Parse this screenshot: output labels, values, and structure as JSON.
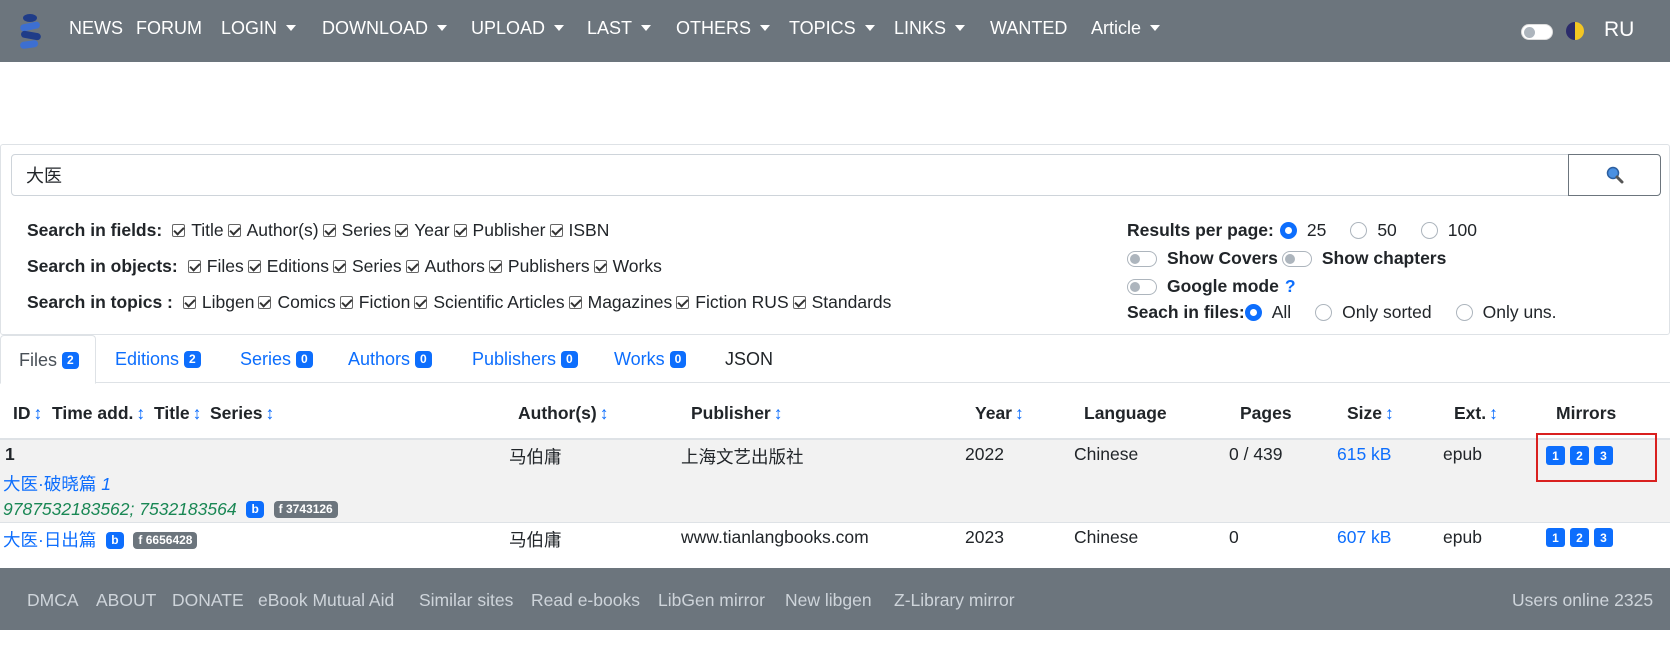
{
  "nav": {
    "items": [
      {
        "label": "NEWS",
        "dropdown": false
      },
      {
        "label": "FORUM",
        "dropdown": false
      },
      {
        "label": "LOGIN",
        "dropdown": true
      },
      {
        "label": "DOWNLOAD",
        "dropdown": true
      },
      {
        "label": "UPLOAD",
        "dropdown": true
      },
      {
        "label": "LAST",
        "dropdown": true
      },
      {
        "label": "OTHERS",
        "dropdown": true
      },
      {
        "label": "TOPICS",
        "dropdown": true
      },
      {
        "label": "LINKS",
        "dropdown": true
      },
      {
        "label": "WANTED",
        "dropdown": false
      },
      {
        "label": "Article",
        "dropdown": true
      }
    ],
    "lang": "RU"
  },
  "search": {
    "query": "大医",
    "fields_label": "Search in fields:",
    "fields": [
      "Title",
      "Author(s)",
      "Series",
      "Year",
      "Publisher",
      "ISBN"
    ],
    "objects_label": "Search in objects:",
    "objects": [
      "Files",
      "Editions",
      "Series",
      "Authors",
      "Publishers",
      "Works"
    ],
    "topics_label": "Search in topics :",
    "topics": [
      "Libgen",
      "Comics",
      "Fiction",
      "Scientific Articles",
      "Magazines",
      "Fiction RUS",
      "Standards"
    ],
    "results_label": "Results per page:",
    "results_options": [
      "25",
      "50",
      "100"
    ],
    "results_selected": "25",
    "show_covers": "Show Covers",
    "show_chapters": "Show chapters",
    "google_mode": "Google mode",
    "google_help": "?",
    "files_label": "Seach in files:",
    "files_options": [
      "All",
      "Only sorted",
      "Only uns."
    ],
    "files_selected": "All"
  },
  "tabs": [
    {
      "label": "Files",
      "count": "2",
      "active": true
    },
    {
      "label": "Editions",
      "count": "2"
    },
    {
      "label": "Series",
      "count": "0"
    },
    {
      "label": "Authors",
      "count": "0"
    },
    {
      "label": "Publishers",
      "count": "0"
    },
    {
      "label": "Works",
      "count": "0"
    },
    {
      "label": "JSON",
      "count": null
    }
  ],
  "table": {
    "headers": {
      "id": "ID",
      "time": "Time add.",
      "title": "Title",
      "series": "Series",
      "authors": "Author(s)",
      "publisher": "Publisher",
      "year": "Year",
      "language": "Language",
      "pages": "Pages",
      "size": "Size",
      "ext": "Ext.",
      "mirrors": "Mirrors"
    },
    "sort_glyph": "↕",
    "rows": [
      {
        "id": "1",
        "title": "大医·破晓篇",
        "series_num": "1",
        "isbn": "9787532183562; 7532183564",
        "b": "b",
        "f": "f 3743126",
        "author": "马伯庸",
        "publisher": "上海文艺出版社",
        "year": "2022",
        "language": "Chinese",
        "pages": "0 / 439",
        "size": "615 kB",
        "ext": "epub",
        "mirrors": [
          "1",
          "2",
          "3"
        ]
      },
      {
        "id": "",
        "title": "大医·日出篇",
        "b": "b",
        "f": "f 6656428",
        "author": "马伯庸",
        "publisher": "www.tianlangbooks.com",
        "year": "2023",
        "language": "Chinese",
        "pages": "0",
        "size": "607 kB",
        "ext": "epub",
        "mirrors": [
          "1",
          "2",
          "3"
        ]
      }
    ]
  },
  "footer": {
    "links": [
      "DMCA",
      "ABOUT",
      "DONATE",
      "eBook Mutual Aid",
      "Similar sites",
      "Read e-books",
      "LibGen mirror",
      "New libgen",
      "Z-Library mirror"
    ],
    "users_online": "Users online 2325"
  },
  "colors": {
    "navbar": "#6c757d",
    "accent": "#0d6efd",
    "isbn": "#198754",
    "highlight": "#d9201f"
  }
}
